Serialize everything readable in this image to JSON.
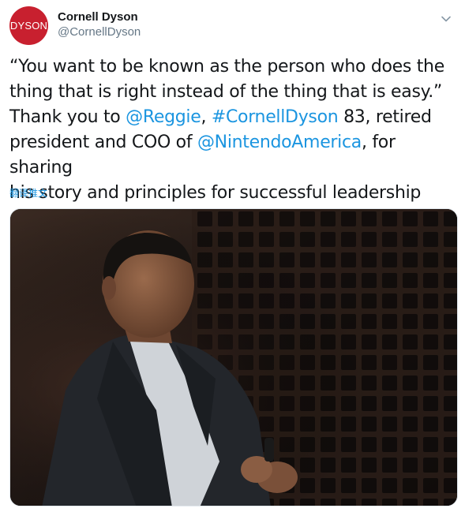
{
  "user": {
    "display_name": "Cornell Dyson",
    "handle": "@CornellDyson",
    "avatar_text": "DYSON",
    "avatar_color": "#c8202f"
  },
  "tweet": {
    "line1": "“You want to be known as the person who does the",
    "line2": "thing that is right instead of the thing that is easy.”",
    "line3_prefix": "Thank you to ",
    "mention1": "@Reggie",
    "sep1": ", ",
    "hashtag": "#CornellDyson",
    "line3_suffix": " 83, retired",
    "line4_prefix": "president and COO of ",
    "mention2": "@NintendoAmerica",
    "line4_suffix": ", for sharing",
    "line5": "his story and principles for successful leadership"
  },
  "translate_label": "翻译推文",
  "icons": {
    "caret": "chevron-down-icon"
  },
  "colors": {
    "link": "#1b95e0",
    "secondary_text": "#657786"
  }
}
